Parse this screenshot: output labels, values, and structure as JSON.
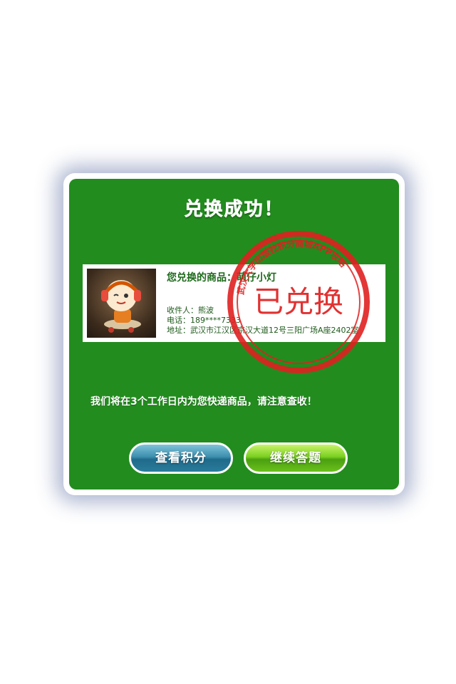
{
  "dialog": {
    "title": "兑换成功！",
    "product": {
      "label": "您兑换的商品：",
      "name": "萌仔小灯",
      "image_icon": "lamp-toy-photo"
    },
    "recipient": {
      "name_line": "收件人：熊波",
      "phone_line": "电话：189****7333",
      "address_line": "地址：武汉市江汉区京汉大道12号三阳广场A座2402室"
    },
    "stamp": {
      "main_text": "已兑换",
      "ring_text": "武汉大学出版社积分商城APP攻略",
      "color": "#e02020"
    },
    "notice": "我们将在3个工作日内为您快递商品，请注意查收！",
    "buttons": {
      "view_points": "查看积分",
      "continue_quiz": "继续答题"
    }
  },
  "colors": {
    "panel_green": "#228c1e",
    "button_blue": "#2a7c9c",
    "button_green": "#6cc01c"
  }
}
